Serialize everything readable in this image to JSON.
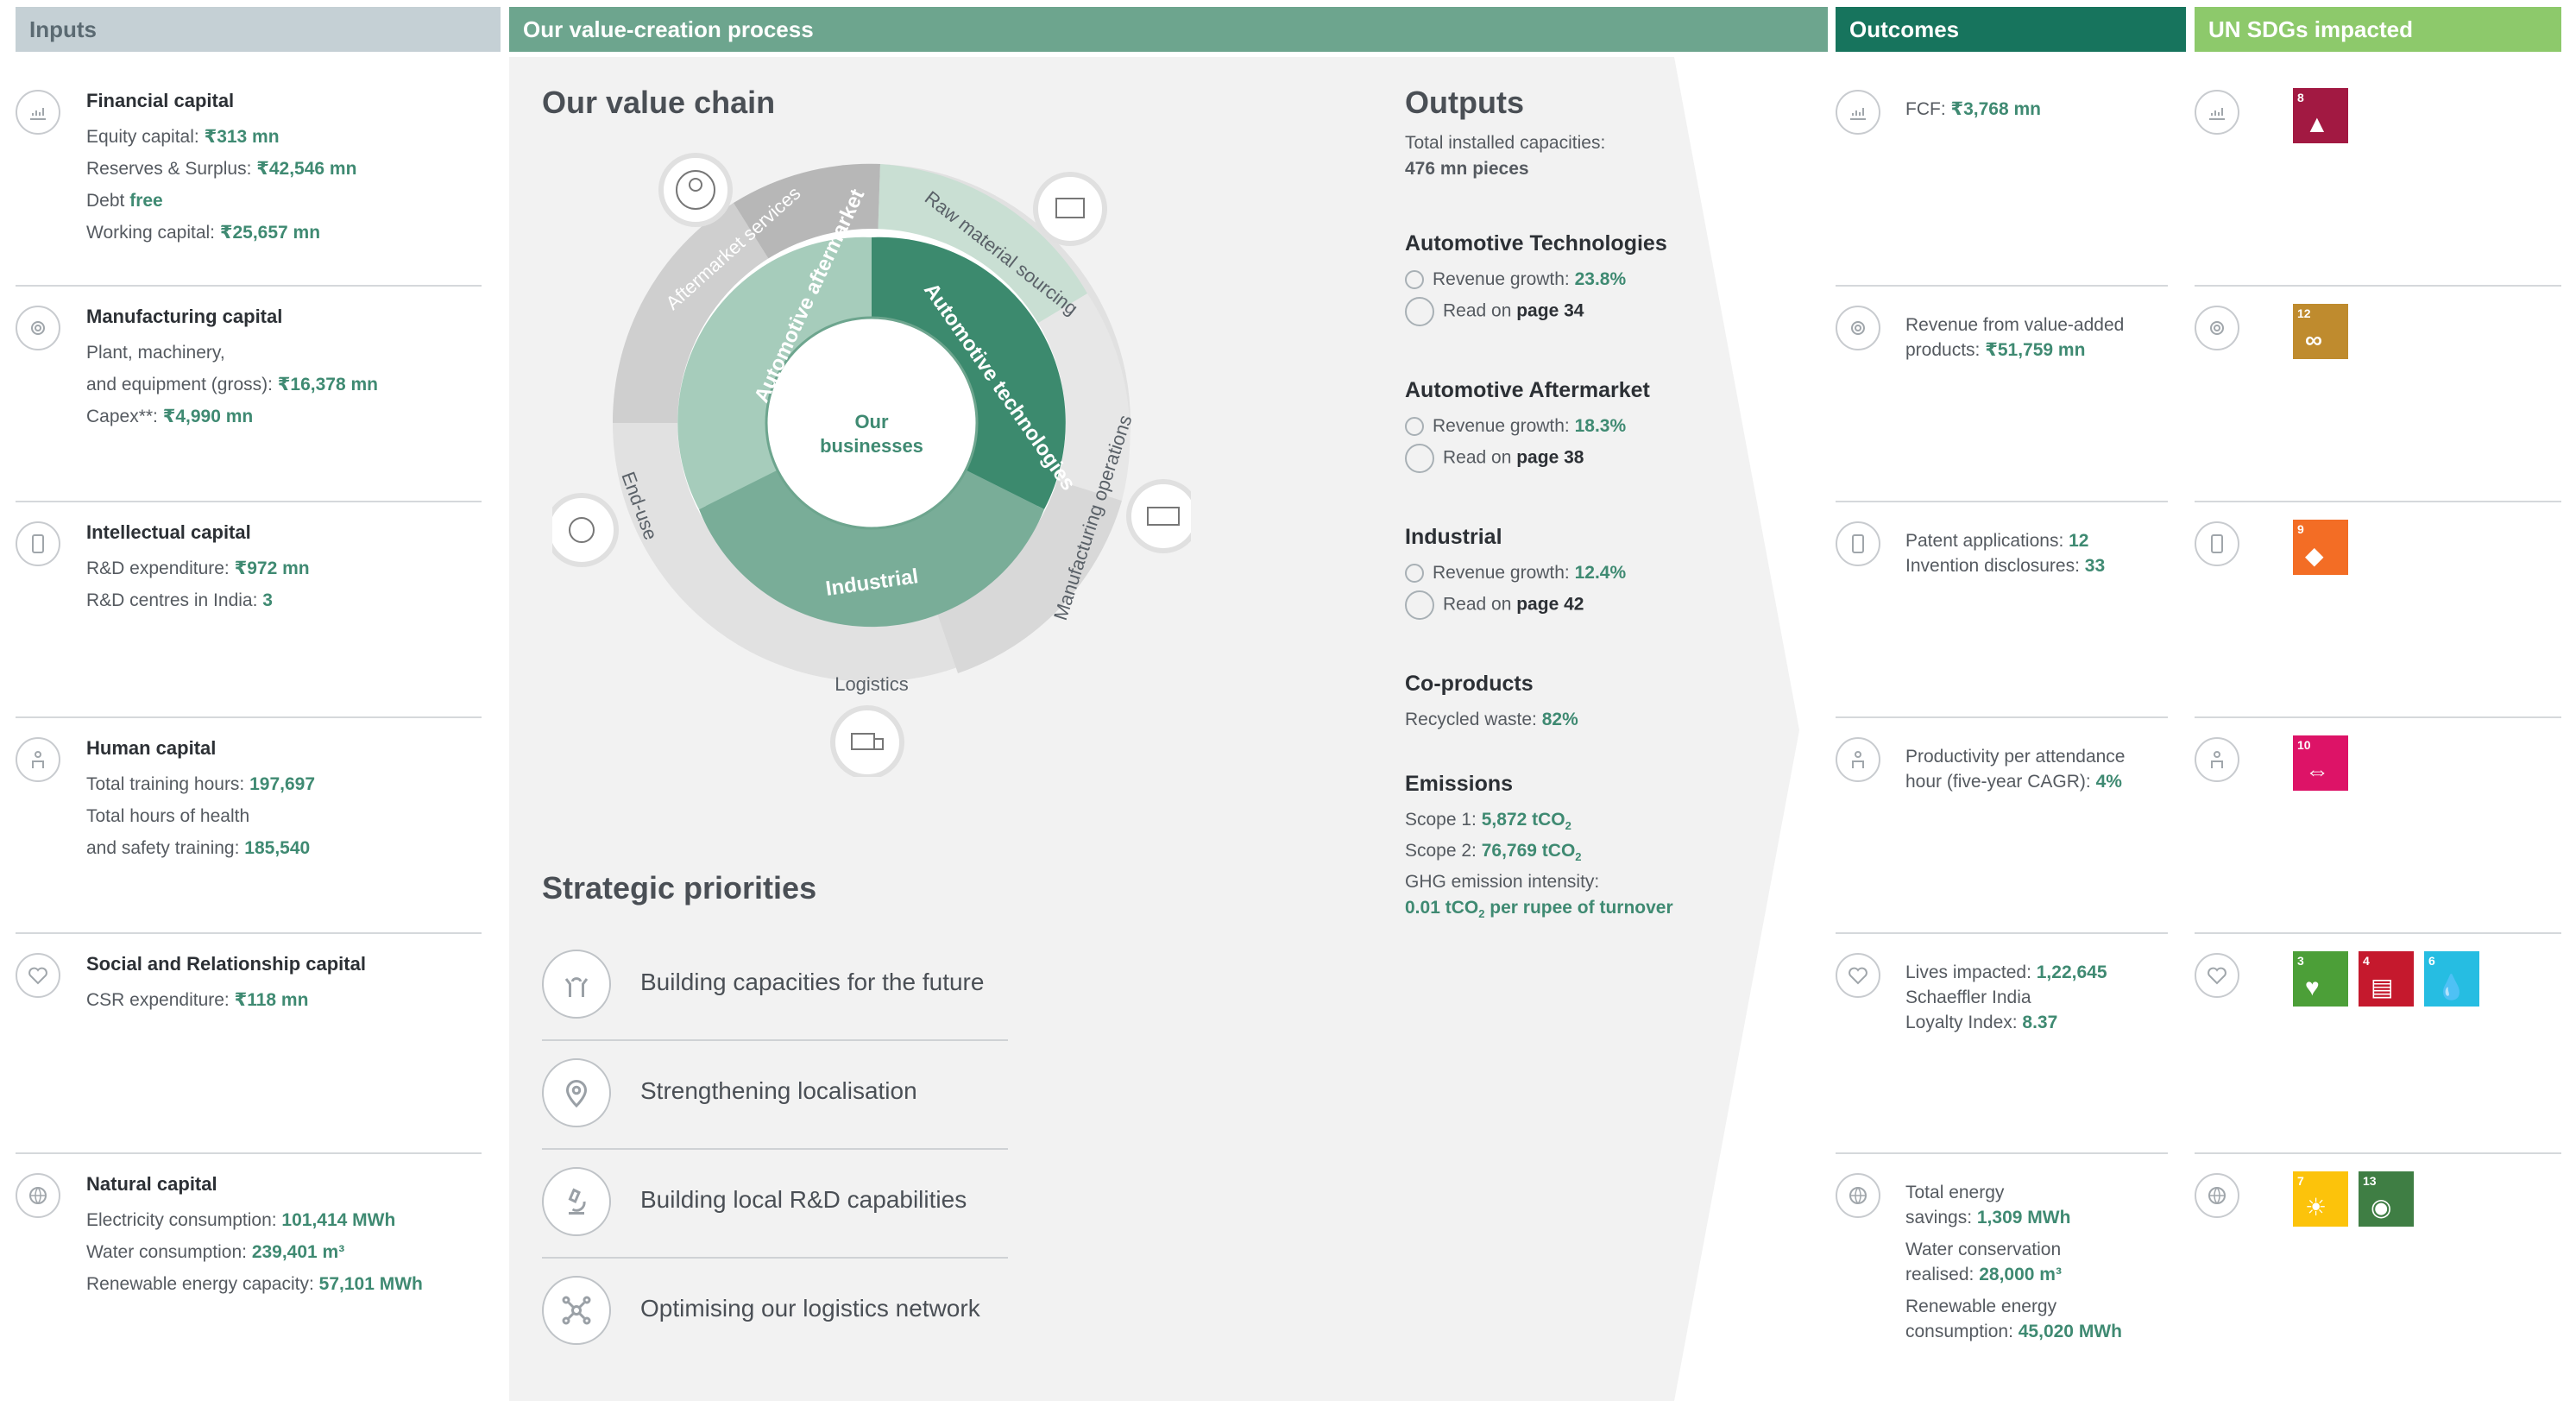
{
  "headers": {
    "inputs": "Inputs",
    "process": "Our value-creation process",
    "outcomes": "Outcomes",
    "sdgs": "UN SDGs impacted"
  },
  "colors": {
    "inputs_header": "#c5d0d5",
    "process_header": "#6da58e",
    "outcomes_header": "#17745d",
    "sdgs_header": "#8dc96b",
    "accent": "#3f8a72"
  },
  "inputs": [
    {
      "title": "Financial capital",
      "icon": "chart-icon",
      "lines": [
        {
          "label": "Equity capital: ",
          "value": "₹313 mn"
        },
        {
          "label": "Reserves & Surplus: ",
          "value": "₹42,546 mn"
        },
        {
          "label": "Debt ",
          "value": "free"
        },
        {
          "label": "Working capital: ",
          "value": "₹25,657 mn"
        }
      ]
    },
    {
      "title": "Manufacturing capital",
      "icon": "gear-icon",
      "lines": [
        {
          "label": "Plant, machinery,",
          "value": ""
        },
        {
          "label": "and equipment (gross): ",
          "value": "₹16,378 mn"
        },
        {
          "label": "Capex**: ",
          "value": "₹4,990 mn"
        }
      ]
    },
    {
      "title": "Intellectual capital",
      "icon": "device-icon",
      "lines": [
        {
          "label": "R&D expenditure: ",
          "value": "₹972 mn"
        },
        {
          "label": "R&D centres in India: ",
          "value": "3"
        }
      ]
    },
    {
      "title": "Human capital",
      "icon": "person-icon",
      "lines": [
        {
          "label": "Total training hours: ",
          "value": "197,697"
        },
        {
          "label": "Total hours of health",
          "value": ""
        },
        {
          "label": "and safety training: ",
          "value": "185,540"
        }
      ]
    },
    {
      "title": "Social and Relationship capital",
      "icon": "heart-icon",
      "lines": [
        {
          "label": "CSR expenditure: ",
          "value": "₹118 mn"
        }
      ]
    },
    {
      "title": "Natural capital",
      "icon": "globe-icon",
      "lines": [
        {
          "label": "Electricity consumption: ",
          "value": "101,414 MWh"
        },
        {
          "label": "Water consumption: ",
          "value": "239,401 m³"
        },
        {
          "label": "Renewable energy capacity: ",
          "value": "57,101 MWh"
        }
      ]
    }
  ],
  "value_chain": {
    "title": "Our value chain",
    "center": "Our businesses",
    "businesses": [
      "Automotive aftermarket",
      "Automotive technologies",
      "Industrial"
    ],
    "stages": [
      "Aftermarket services",
      "Raw material sourcing",
      "Manufacturing operations",
      "Logistics",
      "End-use"
    ]
  },
  "priorities": {
    "title": "Strategic priorities",
    "items": [
      {
        "label": "Building capacities for the future",
        "icon": "hands-icon"
      },
      {
        "label": "Strengthening localisation",
        "icon": "location-icon"
      },
      {
        "label": "Building local R&D capabilities",
        "icon": "microscope-icon"
      },
      {
        "label": "Optimising our logistics network",
        "icon": "network-icon"
      }
    ]
  },
  "outputs": {
    "title": "Outputs",
    "installed_label": "Total installed capacities:",
    "installed_value": "476 mn pieces",
    "segments": [
      {
        "name": "Automotive Technologies",
        "growth_label": "Revenue growth: ",
        "growth": "23.8%",
        "read_label": "Read on ",
        "page": "page 34"
      },
      {
        "name": "Automotive Aftermarket",
        "growth_label": "Revenue growth: ",
        "growth": "18.3%",
        "read_label": "Read on ",
        "page": "page 38"
      },
      {
        "name": "Industrial",
        "growth_label": "Revenue growth: ",
        "growth": "12.4%",
        "read_label": "Read on ",
        "page": "page 42"
      }
    ],
    "coproducts_title": "Co-products",
    "coproducts_label": "Recycled waste: ",
    "coproducts_value": "82%",
    "emissions_title": "Emissions",
    "scope1_label": "Scope 1: ",
    "scope1_value": "5,872 tCO",
    "scope2_label": "Scope 2: ",
    "scope2_value": "76,769 tCO",
    "ghg_label": "GHG emission intensity:",
    "ghg_value": "0.01 tCO",
    "ghg_suffix": " per rupee of turnover",
    "sub2": "2"
  },
  "outcomes": [
    {
      "icon": "chart-icon",
      "lines": [
        {
          "label": "FCF: ",
          "value": "₹3,768 mn"
        }
      ]
    },
    {
      "icon": "gear-icon",
      "lines": [
        {
          "label": "Revenue from value-added",
          "value": ""
        },
        {
          "label": "products: ",
          "value": "₹51,759 mn"
        }
      ]
    },
    {
      "icon": "device-icon",
      "lines": [
        {
          "label": "Patent applications: ",
          "value": "12"
        },
        {
          "label": "Invention disclosures: ",
          "value": "33"
        }
      ]
    },
    {
      "icon": "person-icon",
      "lines": [
        {
          "label": "Productivity per attendance",
          "value": ""
        },
        {
          "label": "hour (five-year CAGR): ",
          "value": "4%"
        }
      ]
    },
    {
      "icon": "heart-icon",
      "lines": [
        {
          "label": "Lives impacted: ",
          "value": "1,22,645"
        },
        {
          "label": "Schaeffler India",
          "value": ""
        },
        {
          "label": "Loyalty Index: ",
          "value": "8.37"
        }
      ]
    },
    {
      "icon": "globe-icon",
      "lines": [
        {
          "label": "Total energy",
          "value": ""
        },
        {
          "label": "savings: ",
          "value": "1,309 MWh"
        },
        {
          "label": "Water conservation",
          "value": ""
        },
        {
          "label": "realised: ",
          "value": "28,000 m³"
        },
        {
          "label": "Renewable energy",
          "value": ""
        },
        {
          "label": "consumption: ",
          "value": "45,020 MWh"
        }
      ]
    }
  ],
  "sdgs": [
    [
      {
        "num": "8",
        "color": "#a21942",
        "symbol": "▲"
      }
    ],
    [
      {
        "num": "12",
        "color": "#bf8b2e",
        "symbol": "∞"
      }
    ],
    [
      {
        "num": "9",
        "color": "#f36d25",
        "symbol": "◆"
      }
    ],
    [
      {
        "num": "10",
        "color": "#dd1367",
        "symbol": "⇔"
      }
    ],
    [
      {
        "num": "3",
        "color": "#4c9f38",
        "symbol": "♥"
      },
      {
        "num": "4",
        "color": "#c5192d",
        "symbol": "▤"
      },
      {
        "num": "6",
        "color": "#26bde2",
        "symbol": "💧"
      }
    ],
    [
      {
        "num": "7",
        "color": "#fcc30b",
        "symbol": "☀"
      },
      {
        "num": "13",
        "color": "#3f7e44",
        "symbol": "◉"
      }
    ]
  ]
}
